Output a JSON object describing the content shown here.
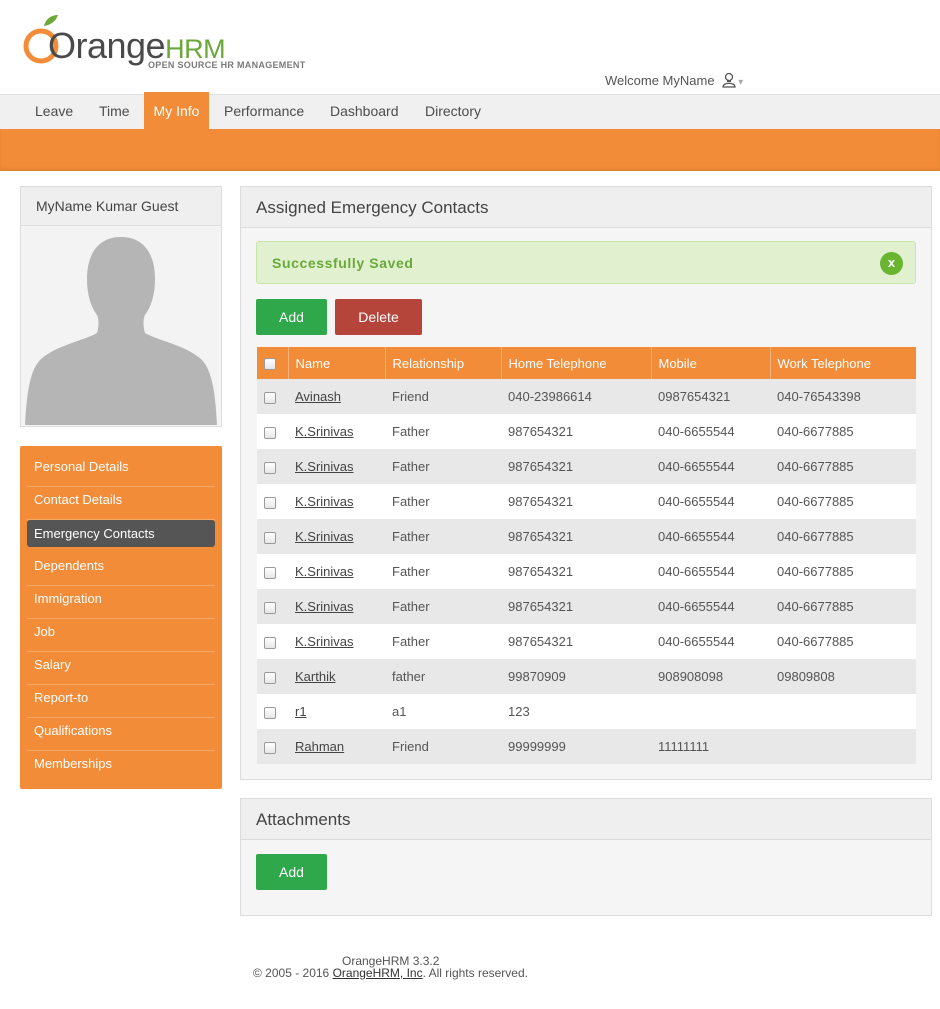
{
  "brand": {
    "name_part1": "Orange",
    "name_part2": "HRM",
    "tagline": "OPEN SOURCE HR MANAGEMENT",
    "accent_color": "#f28c38",
    "green_color": "#6aa83a"
  },
  "header": {
    "welcome": "Welcome MyName",
    "user_icon": "user-icon",
    "caret": "▾"
  },
  "topnav": {
    "tabs": [
      {
        "label": "Leave"
      },
      {
        "label": "Time"
      },
      {
        "label": "My Info",
        "active": true
      },
      {
        "label": "Performance"
      },
      {
        "label": "Dashboard"
      },
      {
        "label": "Directory"
      }
    ]
  },
  "profile": {
    "name": "MyName Kumar Guest"
  },
  "sidebar": {
    "items": [
      {
        "label": "Personal Details"
      },
      {
        "label": "Contact Details"
      },
      {
        "label": "Emergency Contacts",
        "active": true
      },
      {
        "label": "Dependents"
      },
      {
        "label": "Immigration"
      },
      {
        "label": "Job"
      },
      {
        "label": "Salary"
      },
      {
        "label": "Report-to"
      },
      {
        "label": "Qualifications"
      },
      {
        "label": "Memberships"
      }
    ]
  },
  "emergency": {
    "title": "Assigned Emergency Contacts",
    "message": "Successfully Saved",
    "close_label": "x",
    "add_label": "Add",
    "delete_label": "Delete",
    "columns": [
      "Name",
      "Relationship",
      "Home Telephone",
      "Mobile",
      "Work Telephone"
    ],
    "rows": [
      {
        "name": "Avinash",
        "relationship": "Friend",
        "home": "040-23986614",
        "mobile": "0987654321",
        "work": "040-76543398"
      },
      {
        "name": "K.Srinivas",
        "relationship": "Father",
        "home": "987654321",
        "mobile": "040-6655544",
        "work": "040-6677885"
      },
      {
        "name": "K.Srinivas",
        "relationship": "Father",
        "home": "987654321",
        "mobile": "040-6655544",
        "work": "040-6677885"
      },
      {
        "name": "K.Srinivas",
        "relationship": "Father",
        "home": "987654321",
        "mobile": "040-6655544",
        "work": "040-6677885"
      },
      {
        "name": "K.Srinivas",
        "relationship": "Father",
        "home": "987654321",
        "mobile": "040-6655544",
        "work": "040-6677885"
      },
      {
        "name": "K.Srinivas",
        "relationship": "Father",
        "home": "987654321",
        "mobile": "040-6655544",
        "work": "040-6677885"
      },
      {
        "name": "K.Srinivas",
        "relationship": "Father",
        "home": "987654321",
        "mobile": "040-6655544",
        "work": "040-6677885"
      },
      {
        "name": "K.Srinivas",
        "relationship": "Father",
        "home": "987654321",
        "mobile": "040-6655544",
        "work": "040-6677885"
      },
      {
        "name": "Karthik",
        "relationship": "father",
        "home": "99870909",
        "mobile": "908908098",
        "work": "09809808"
      },
      {
        "name": "r1",
        "relationship": "a1",
        "home": "123",
        "mobile": "",
        "work": ""
      },
      {
        "name": "Rahman",
        "relationship": "Friend",
        "home": "99999999",
        "mobile": "11111111",
        "work": ""
      }
    ]
  },
  "attachments": {
    "title": "Attachments",
    "add_label": "Add"
  },
  "footer": {
    "version": "OrangeHRM 3.3.2",
    "copy_prefix": "© 2005 - 2016 ",
    "copy_link": "OrangeHRM, Inc",
    "copy_suffix": ". All rights reserved."
  }
}
